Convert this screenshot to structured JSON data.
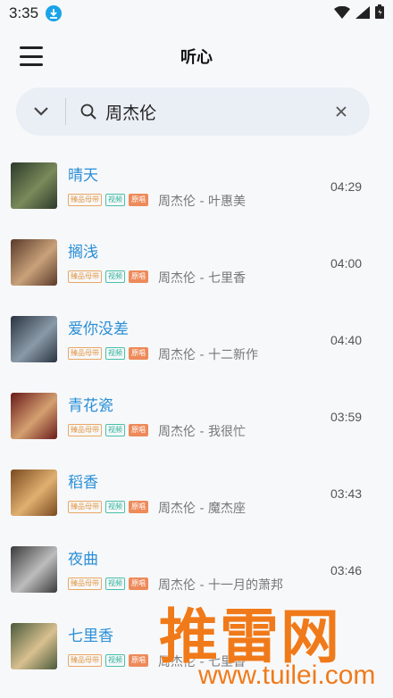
{
  "status": {
    "time": "3:35"
  },
  "header": {
    "title": "听心"
  },
  "search": {
    "query": "周杰伦"
  },
  "tags": {
    "hq": "臻品母带",
    "mv": "视频",
    "orig": "原唱"
  },
  "songs": [
    {
      "title": "晴天",
      "meta": "周杰伦 - 叶惠美",
      "duration": "04:29",
      "cover_colors": [
        "#2c3a2a",
        "#7a8a5a"
      ]
    },
    {
      "title": "搁浅",
      "meta": "周杰伦 - 七里香",
      "duration": "04:00",
      "cover_colors": [
        "#5a3a2a",
        "#c9a27a"
      ]
    },
    {
      "title": "爱你没差",
      "meta": "周杰伦 - 十二新作",
      "duration": "04:40",
      "cover_colors": [
        "#2a3440",
        "#8a9aa8"
      ]
    },
    {
      "title": "青花瓷",
      "meta": "周杰伦 - 我很忙",
      "duration": "03:59",
      "cover_colors": [
        "#6a1a1a",
        "#d4a070"
      ]
    },
    {
      "title": "稻香",
      "meta": "周杰伦 - 魔杰座",
      "duration": "03:43",
      "cover_colors": [
        "#7a4a20",
        "#e0b070"
      ]
    },
    {
      "title": "夜曲",
      "meta": "周杰伦 - 十一月的萧邦",
      "duration": "03:46",
      "cover_colors": [
        "#3a3a3a",
        "#bdbdbd"
      ]
    },
    {
      "title": "七里香",
      "meta": "周杰伦 - 七里香",
      "duration": "",
      "cover_colors": [
        "#4a5a3a",
        "#d8c090"
      ]
    }
  ],
  "watermark": {
    "main": "推雷网",
    "url": "www.tuilei.com"
  }
}
